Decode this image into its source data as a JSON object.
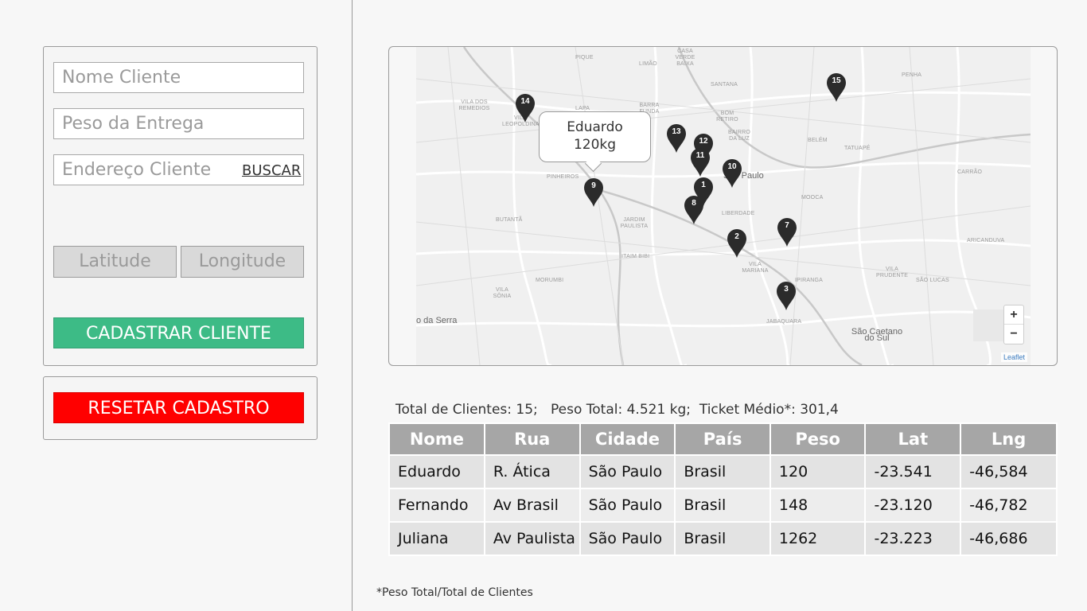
{
  "form": {
    "name_placeholder": "Nome Cliente",
    "weight_placeholder": "Peso da Entrega",
    "address_placeholder": "Endereço Cliente",
    "search_label": "BUSCAR",
    "latitude_label": "Latitude",
    "longitude_label": "Longitude",
    "register_label": "CADASTRAR CLIENTE",
    "reset_label": "RESETAR CADASTRO"
  },
  "map": {
    "popup_name": "Eduardo",
    "popup_weight": "120kg",
    "zoom_in": "+",
    "zoom_out": "−",
    "attribution": "Leaflet",
    "markers": [
      "1",
      "2",
      "3",
      "7",
      "8",
      "9",
      "10",
      "11",
      "12",
      "13",
      "14",
      "15"
    ],
    "labels": {
      "sao_paulo": "São Paulo",
      "sao_caetano": "São Caetano do Sul",
      "serra": "o da Serra",
      "l1": "Pique",
      "l2": "Casa Verde Baixa",
      "l3": "Limão",
      "l4": "Santana",
      "l5": "Vila dos Remedios",
      "l6": "Vila Leopoldina",
      "l7": "Lapa",
      "l8": "Barra Funda",
      "l9": "Bom Retiro",
      "l10": "Bairro da Luz",
      "l11": "Belém",
      "l12": "Tatuapé",
      "l13": "Pinheiros",
      "l14": "Jardim Paulista",
      "l15": "Itaim Bibi",
      "l16": "Vila Mariana",
      "l17": "Liberdade",
      "l18": "Mooca",
      "l19": "Butantã",
      "l20": "Morumbi",
      "l21": "Vila Sônia",
      "l22": "Ipiranga",
      "l23": "Jabaquara",
      "l24": "Aricanduva",
      "l25": "Vila Prudente",
      "l26": "São Lucas",
      "l27": "Carrão",
      "l28": "Penha"
    }
  },
  "summary": {
    "text": "Total de Clientes: 15;   Peso Total: 4.521 kg;  Ticket Médio*: 301,4"
  },
  "table": {
    "headers": [
      "Nome",
      "Rua",
      "Cidade",
      "País",
      "Peso",
      "Lat",
      "Lng"
    ],
    "rows": [
      [
        "Eduardo",
        "R. Ática",
        "São Paulo",
        "Brasil",
        "120",
        "-23.541",
        "-46,584"
      ],
      [
        "Fernando",
        "Av Brasil",
        "São Paulo",
        "Brasil",
        "148",
        "-23.120",
        "-46,782"
      ],
      [
        "Juliana",
        "Av Paulista",
        "São Paulo",
        "Brasil",
        "1262",
        "-23.223",
        "-46,686"
      ]
    ]
  },
  "footnote": "*Peso Total/Total de Clientes",
  "colors": {
    "green": "#3dbb86",
    "red": "#ff0000",
    "header_gray": "#a6a6a6"
  }
}
